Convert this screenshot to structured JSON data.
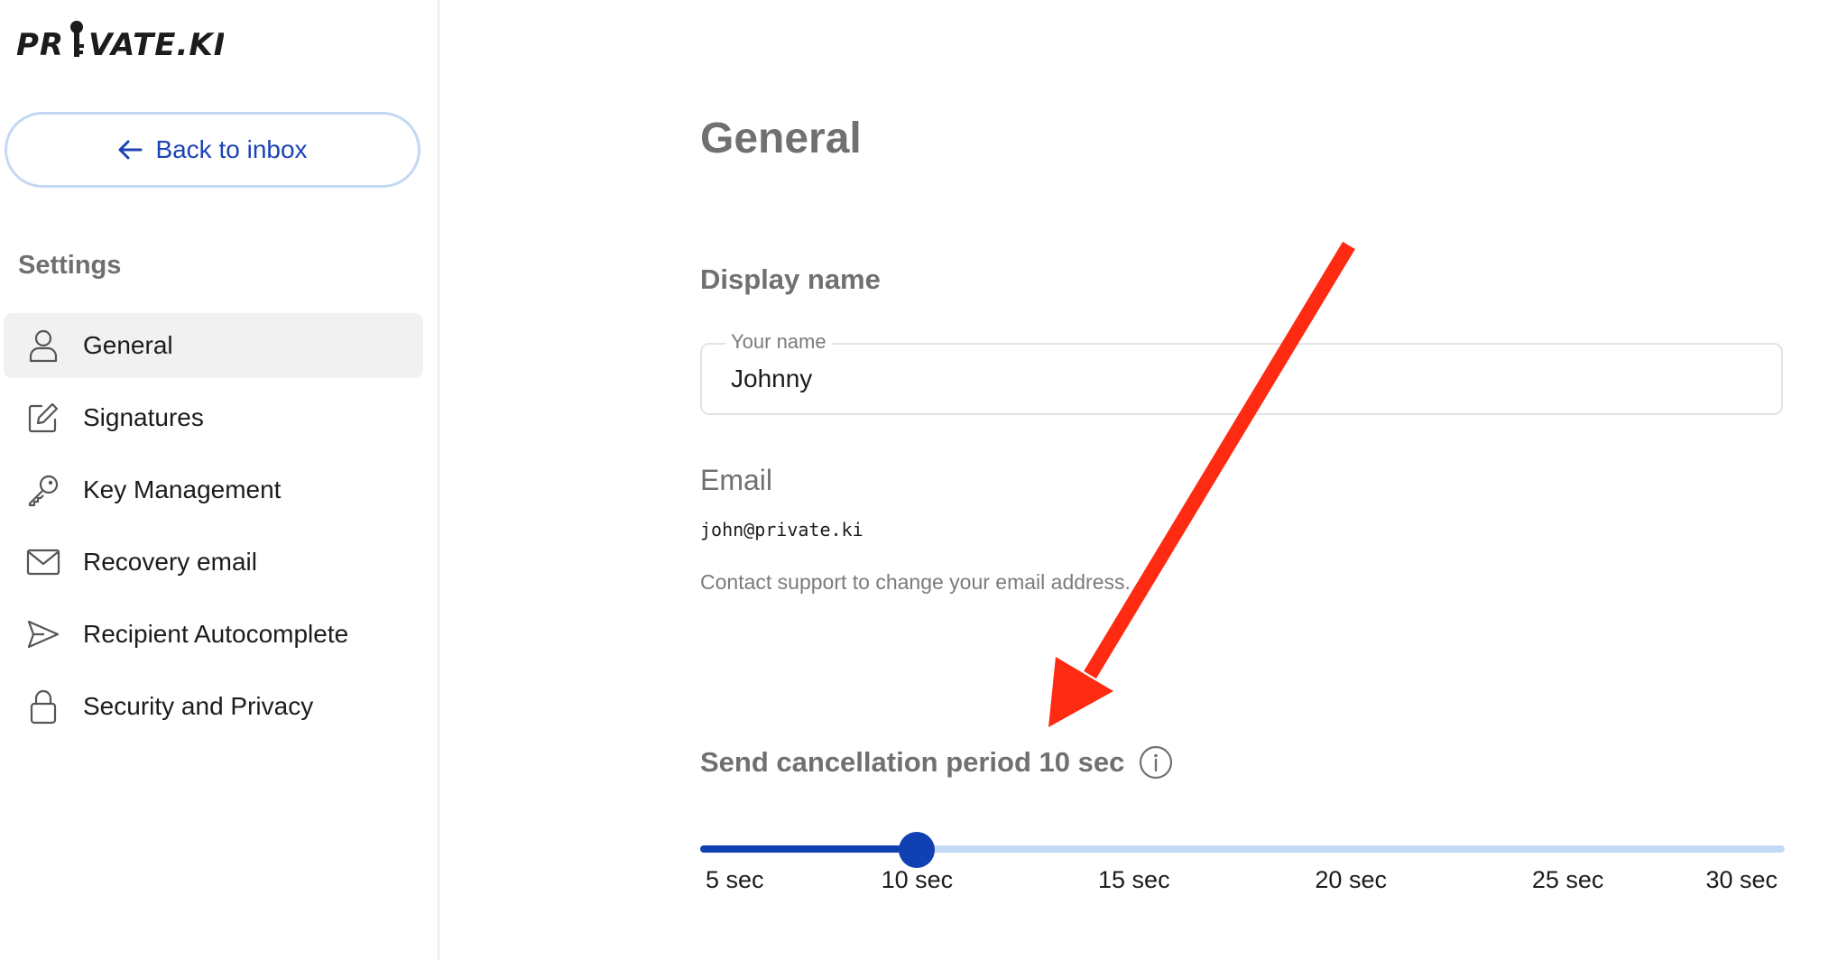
{
  "brand": {
    "logo_text": "PRIVATE.KI"
  },
  "sidebar": {
    "back_button": "Back to inbox",
    "section_title": "Settings",
    "items": [
      {
        "label": "General",
        "icon": "user-icon",
        "active": true
      },
      {
        "label": "Signatures",
        "icon": "pencil-icon",
        "active": false
      },
      {
        "label": "Key Management",
        "icon": "key-icon",
        "active": false
      },
      {
        "label": "Recovery email",
        "icon": "envelope-icon",
        "active": false
      },
      {
        "label": "Recipient Autocomplete",
        "icon": "send-icon",
        "active": false
      },
      {
        "label": "Security and Privacy",
        "icon": "lock-icon",
        "active": false
      }
    ]
  },
  "main": {
    "title": "General",
    "display_name": {
      "heading": "Display name",
      "legend": "Your name",
      "value": "Johnny"
    },
    "email": {
      "heading": "Email",
      "value": "john@private.ki",
      "hint": "Contact support to change your email address."
    },
    "cancellation": {
      "heading": "Send cancellation period 10 sec",
      "info_icon": "info-icon",
      "slider": {
        "min": 5,
        "max": 30,
        "value": 10,
        "marks": [
          {
            "value": 5,
            "label": "5 sec"
          },
          {
            "value": 10,
            "label": "10 sec"
          },
          {
            "value": 15,
            "label": "15 sec"
          },
          {
            "value": 20,
            "label": "20 sec"
          },
          {
            "value": 25,
            "label": "25 sec"
          },
          {
            "value": 30,
            "label": "30 sec"
          }
        ]
      }
    }
  },
  "colors": {
    "accent": "#1040b2",
    "rail": "#c3daf6",
    "annotation_arrow": "#ff2a12"
  }
}
